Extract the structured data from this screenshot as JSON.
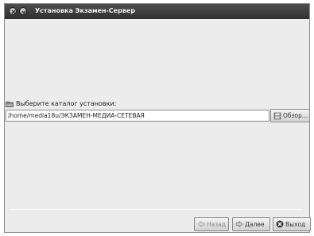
{
  "window": {
    "title": "Установка Экзамен-Сервер"
  },
  "install_dir": {
    "label": "Выберите каталог установки:",
    "value": "/home/media18u/ЭКЗАМЕН-МЕДИА-СЕТЕВАЯ",
    "browse_label": "Обзор..."
  },
  "nav": {
    "back_label": "Назад",
    "next_label": "Далее",
    "exit_label": "Выход"
  }
}
